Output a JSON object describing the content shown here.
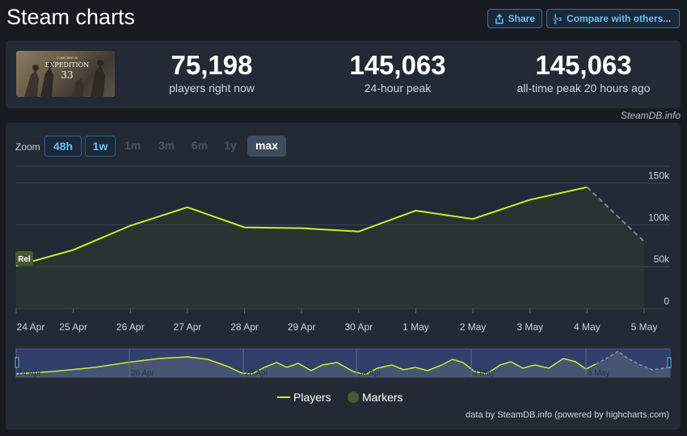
{
  "header": {
    "title": "Steam charts",
    "share_label": "Share",
    "compare_label": "Compare with others..."
  },
  "stats": [
    {
      "value": "75,198",
      "label": "players right now"
    },
    {
      "value": "145,063",
      "label": "24-hour peak"
    },
    {
      "value": "145,063",
      "label": "all-time peak 20 hours ago"
    }
  ],
  "game_image": {
    "caption": "EXPEDITION 33"
  },
  "credit_top": "SteamDB.info",
  "zoom": {
    "label": "Zoom",
    "options": [
      "48h",
      "1w",
      "1m",
      "3m",
      "6m",
      "1y",
      "max"
    ],
    "enabled": [
      "48h",
      "1w"
    ],
    "selected": "max"
  },
  "colors": {
    "players": "#c8f030",
    "markers": "#4a5a30",
    "navigator_bg": "#30406a",
    "accent": "#66c0f4"
  },
  "chart_data": {
    "type": "line",
    "x": [
      "24 Apr",
      "25 Apr",
      "26 Apr",
      "27 Apr",
      "28 Apr",
      "29 Apr",
      "30 Apr",
      "1 May",
      "2 May",
      "3 May",
      "4 May",
      "5 May"
    ],
    "series": [
      {
        "name": "Players",
        "values": [
          51000,
          70000,
          99000,
          121000,
          97000,
          96000,
          92000,
          117000,
          107000,
          130000,
          145063,
          null
        ]
      },
      {
        "name": "Players (in progress)",
        "values": [
          null,
          null,
          null,
          null,
          null,
          null,
          null,
          null,
          null,
          null,
          145063,
          80000
        ]
      }
    ],
    "yticks": [
      "0",
      "50k",
      "100k",
      "150k"
    ],
    "ylim": [
      0,
      170000
    ],
    "markers": [
      {
        "label": "Rel",
        "x": "24 Apr"
      }
    ],
    "legend": [
      "Players",
      "Markers"
    ],
    "legend_position": "bottom",
    "navigator_labels": [
      "24 Apr",
      "26 Apr",
      "28 Apr",
      "30 Apr",
      "2 May",
      "4 May"
    ],
    "grid": true
  },
  "footer_credit": "data by SteamDB.info (powered by highcharts.com)"
}
